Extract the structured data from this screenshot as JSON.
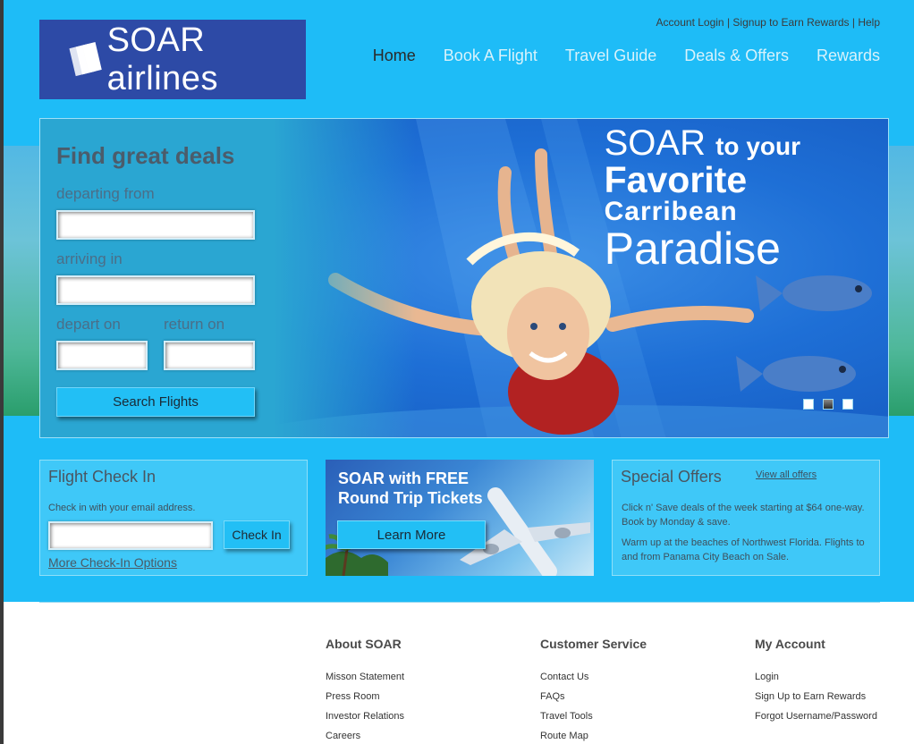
{
  "brand": {
    "logo_text": "SOAR airlines"
  },
  "utility": {
    "login": "Account Login",
    "signup": "Signup to Earn Rewards",
    "help": "Help",
    "sep": "|"
  },
  "nav": [
    "Home",
    "Book A Flight",
    "Travel Guide",
    "Deals & Offers",
    "Rewards"
  ],
  "search": {
    "title": "Find great deals",
    "departing_label": "departing from",
    "arriving_label": "arriving in",
    "depart_on_label": "depart on",
    "return_on_label": "return on",
    "departing_value": "",
    "arriving_value": "",
    "depart_on_value": "",
    "return_on_value": "",
    "button": "Search Flights"
  },
  "hero": {
    "line1_brand": "SOAR",
    "line1_rest": "to your",
    "line2": "Favorite",
    "line3": "Carribean",
    "line4": "Paradise",
    "slides": 3,
    "active_slide": 2
  },
  "checkin": {
    "title": "Flight Check In",
    "hint": "Check in with your email address.",
    "email_value": "",
    "button": "Check In",
    "more_link": "More Check-In Options"
  },
  "promo": {
    "title_line1": "SOAR with FREE",
    "title_line2": "Round Trip Tickets",
    "button": "Learn More"
  },
  "offers": {
    "title": "Special Offers",
    "view_all": "View all offers",
    "offer1": "Click n' Save deals of the week starting at $64 one-way. Book by Monday & save.",
    "offer2": "Warm up at the beaches of Northwest Florida. Flights to and from Panama City Beach on Sale."
  },
  "footer": {
    "about": {
      "title": "About SOAR",
      "links": [
        "Misson Statement",
        "Press Room",
        "Investor Relations",
        "Careers"
      ]
    },
    "service": {
      "title": "Customer Service",
      "links": [
        "Contact Us",
        "FAQs",
        "Travel Tools",
        "Route Map"
      ]
    },
    "account": {
      "title": "My Account",
      "links": [
        "Login",
        "Sign Up to Earn Rewards",
        "Forgot Username/Password"
      ]
    }
  },
  "colors": {
    "sky": "#1ebcf7",
    "logo_bg": "#2d4aa6",
    "button": "#22bff5"
  }
}
